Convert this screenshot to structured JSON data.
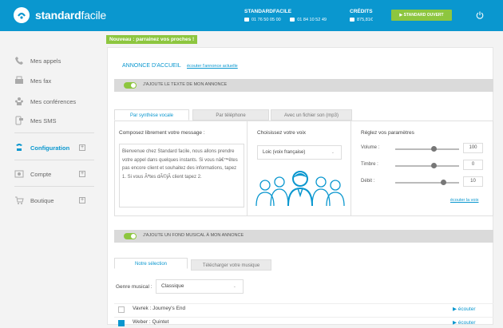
{
  "header": {
    "logo_bold": "standard",
    "logo_light": "facile",
    "sf_title": "STANDARDFACILE",
    "phone1": "01 76 50 05 00",
    "phone2": "01 84 10 52 49",
    "credits_title": "CRÉDITS",
    "credits_value": "875,81€",
    "status_button": "STANDARD OUVERT"
  },
  "sidebar": {
    "items": [
      {
        "label": "Mes appels",
        "icon": "phone-icon"
      },
      {
        "label": "Mes fax",
        "icon": "fax-icon"
      },
      {
        "label": "Mes conférences",
        "icon": "conference-icon"
      },
      {
        "label": "Mes SMS",
        "icon": "sms-icon"
      },
      {
        "label": "Configuration",
        "icon": "configuration-icon"
      },
      {
        "label": "Compte",
        "icon": "account-icon"
      },
      {
        "label": "Boutique",
        "icon": "shop-icon"
      }
    ],
    "plus": "+"
  },
  "banner": "Nouveau : parrainez vos proches !",
  "annonce": {
    "title": "ANNONCE D'ACCUEIL",
    "listen_link": "écouter l'annonce actuelle",
    "toggle_label": "J'AJOUTE LE TEXTE DE MON ANNONCE"
  },
  "tabs": [
    "Par synthèse vocale",
    "Par téléphone",
    "Avec un fichier son (mp3)"
  ],
  "compose": {
    "title": "Composez librement votre message :",
    "text": "Bienvenue chez Standard facile, nous allons prendre votre appel dans quelques instants. Si vous nâ€™êtes pas encore client et souhaitez des informations, tapez 1. Si vous Ãªtes dÃ©jÃ  client tapez 2."
  },
  "voice": {
    "title": "Choisissez votre voix",
    "selected": "Loic (voix française)",
    "chevron": "⌄"
  },
  "params": {
    "title": "Réglez vos paramètres",
    "rows": [
      {
        "label": "Volume :",
        "value": "100",
        "level": 0.6
      },
      {
        "label": "Timbre :",
        "value": "0",
        "level": 0.6
      },
      {
        "label": "Débit :",
        "value": "10",
        "level": 0.75
      }
    ],
    "listen_link": "écouter la voix"
  },
  "music": {
    "toggle_label": "J'AJOUTE UN FOND MUSICAL À MON ANNONCE",
    "tabs": [
      "Notre sélection",
      "Télécharger votre musique"
    ],
    "genre_label": "Genre musical :",
    "genre_value": "Classique",
    "genre_chevron": "⌄",
    "tracks": [
      {
        "name": "Vavrek : Journey's End",
        "checked": false,
        "listen": "▶ écouter"
      },
      {
        "name": "Weber : Quintet",
        "checked": true,
        "listen": "▶ écouter"
      }
    ]
  }
}
